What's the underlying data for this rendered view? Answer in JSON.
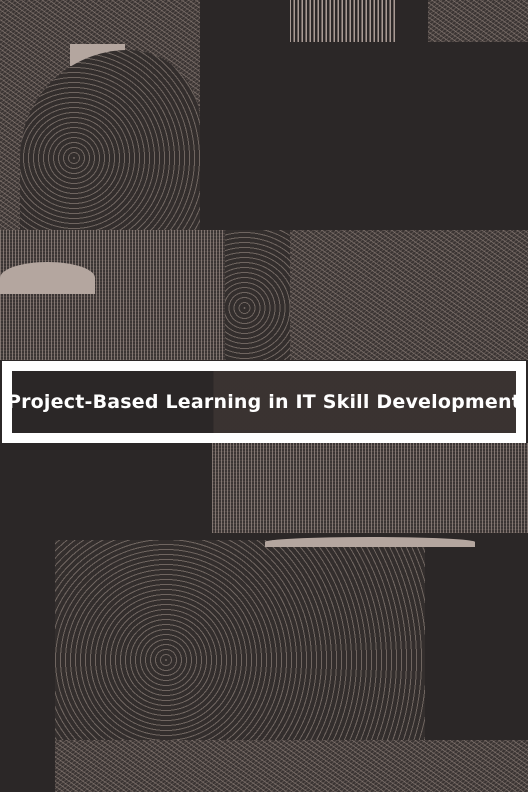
{
  "cover": {
    "title": "Project-Based Learning in IT Skill Development"
  }
}
